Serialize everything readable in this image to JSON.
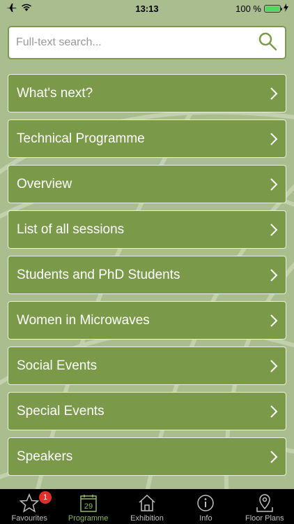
{
  "status_bar": {
    "time": "13:13",
    "battery_percent": "100 %",
    "battery_level": 1.0
  },
  "search": {
    "placeholder": "Full-text search..."
  },
  "menu": {
    "items": [
      {
        "label": "What's next?"
      },
      {
        "label": "Technical Programme"
      },
      {
        "label": "Overview"
      },
      {
        "label": "List of all sessions"
      },
      {
        "label": "Students and PhD Students"
      },
      {
        "label": "Women in Microwaves"
      },
      {
        "label": "Social Events"
      },
      {
        "label": "Special Events"
      },
      {
        "label": "Speakers"
      }
    ]
  },
  "tab_bar": {
    "tabs": [
      {
        "label": "Favourites",
        "icon": "star-icon",
        "badge": "1"
      },
      {
        "label": "Programme",
        "icon": "calendar-icon",
        "calendar_day": "29",
        "active": true
      },
      {
        "label": "Exhibition",
        "icon": "house-icon"
      },
      {
        "label": "Info",
        "icon": "info-icon"
      },
      {
        "label": "Floor Plans",
        "icon": "map-pin-icon"
      }
    ]
  },
  "colors": {
    "background": "#a9bd8f",
    "menu_item": "#7a9a4a",
    "active_tab": "#8dbb5a",
    "badge": "#e0302b"
  }
}
